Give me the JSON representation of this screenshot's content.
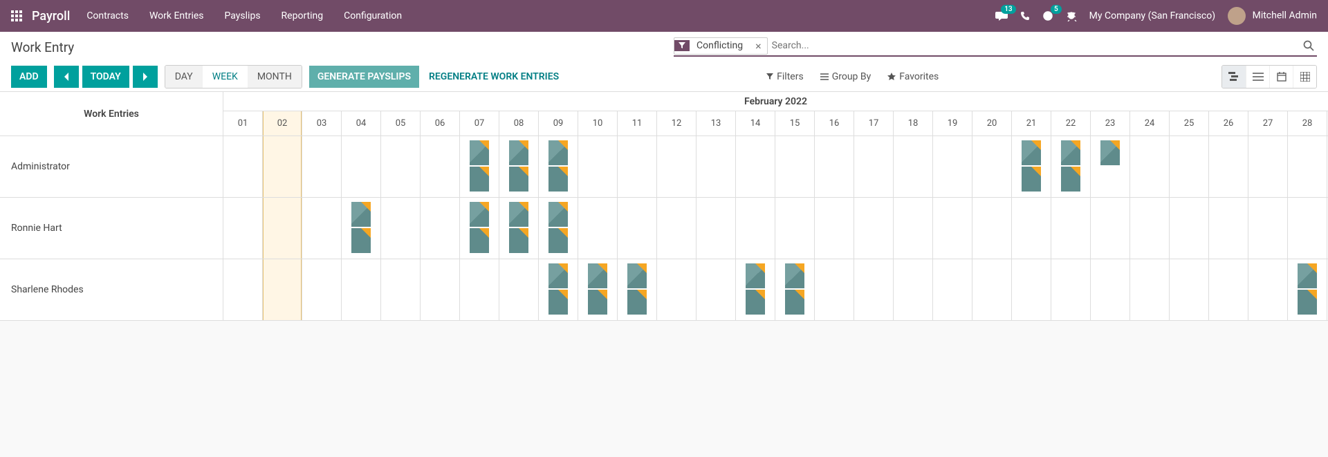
{
  "topbar": {
    "brand": "Payroll",
    "nav": [
      "Contracts",
      "Work Entries",
      "Payslips",
      "Reporting",
      "Configuration"
    ],
    "chat_badge": "13",
    "timer_badge": "5",
    "company": "My Company (San Francisco)",
    "user": "Mitchell Admin"
  },
  "page": {
    "title": "Work Entry"
  },
  "search": {
    "facet_label": "Conflicting",
    "placeholder": "Search..."
  },
  "controls": {
    "add": "ADD",
    "today": "TODAY",
    "day": "DAY",
    "week": "WEEK",
    "month": "MONTH",
    "gen": "GENERATE PAYSLIPS",
    "regen": "REGENERATE WORK ENTRIES",
    "filters": "Filters",
    "group_by": "Group By",
    "favorites": "Favorites"
  },
  "grid": {
    "left_header": "Work Entries",
    "month": "February 2022",
    "days": [
      "01",
      "02",
      "03",
      "04",
      "05",
      "06",
      "07",
      "08",
      "09",
      "10",
      "11",
      "12",
      "13",
      "14",
      "15",
      "16",
      "17",
      "18",
      "19",
      "20",
      "21",
      "22",
      "23",
      "24",
      "25",
      "26",
      "27",
      "28"
    ],
    "highlight_day": "02",
    "employees": [
      {
        "name": "Administrator",
        "entries": [
          {
            "d": "07",
            "n": 2
          },
          {
            "d": "08",
            "n": 2
          },
          {
            "d": "09",
            "n": 2
          },
          {
            "d": "21",
            "n": 2
          },
          {
            "d": "22",
            "n": 2
          },
          {
            "d": "23",
            "n": 1
          }
        ]
      },
      {
        "name": "Ronnie Hart",
        "entries": [
          {
            "d": "04",
            "n": 2
          },
          {
            "d": "07",
            "n": 2
          },
          {
            "d": "08",
            "n": 2
          },
          {
            "d": "09",
            "n": 2
          }
        ]
      },
      {
        "name": "Sharlene Rhodes",
        "entries": [
          {
            "d": "09",
            "n": 2
          },
          {
            "d": "10",
            "n": 2
          },
          {
            "d": "11",
            "n": 2
          },
          {
            "d": "14",
            "n": 2
          },
          {
            "d": "15",
            "n": 2
          },
          {
            "d": "28",
            "n": 2
          }
        ]
      }
    ]
  }
}
